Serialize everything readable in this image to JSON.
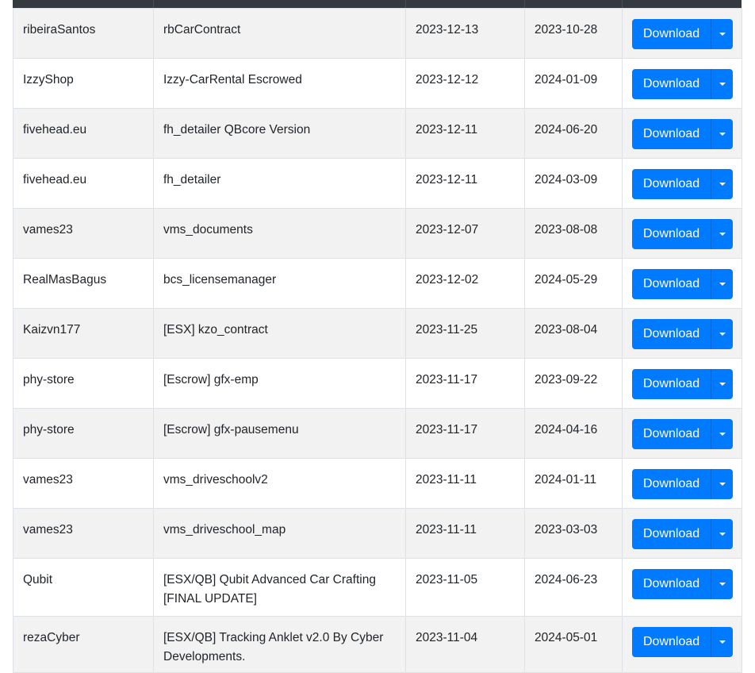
{
  "colors": {
    "header_bg": "#343a40",
    "button_primary": "#007bff",
    "stripe": "#f2f2f2"
  },
  "rows": [
    {
      "author": "ribeiraSantos",
      "name": "rbCarContract",
      "date1": "2023-12-13",
      "date2": "2023-10-28",
      "action": "Download"
    },
    {
      "author": "IzzyShop",
      "name": "Izzy-CarRental Escrowed",
      "date1": "2023-12-12",
      "date2": "2024-01-09",
      "action": "Download"
    },
    {
      "author": "fivehead.eu",
      "name": "fh_detailer QBcore Version",
      "date1": "2023-12-11",
      "date2": "2024-06-20",
      "action": "Download"
    },
    {
      "author": "fivehead.eu",
      "name": "fh_detailer",
      "date1": "2023-12-11",
      "date2": "2024-03-09",
      "action": "Download"
    },
    {
      "author": "vames23",
      "name": "vms_documents",
      "date1": "2023-12-07",
      "date2": "2023-08-08",
      "action": "Download"
    },
    {
      "author": "RealMasBagus",
      "name": "bcs_licensemanager",
      "date1": "2023-12-02",
      "date2": "2024-05-29",
      "action": "Download"
    },
    {
      "author": "Kaizvn177",
      "name": "[ESX] kzo_contract",
      "date1": "2023-11-25",
      "date2": "2023-08-04",
      "action": "Download"
    },
    {
      "author": "phy-store",
      "name": "[Escrow] gfx-emp",
      "date1": "2023-11-17",
      "date2": "2023-09-22",
      "action": "Download"
    },
    {
      "author": "phy-store",
      "name": "[Escrow] gfx-pausemenu",
      "date1": "2023-11-17",
      "date2": "2024-04-16",
      "action": "Download"
    },
    {
      "author": "vames23",
      "name": "vms_driveschoolv2",
      "date1": "2023-11-11",
      "date2": "2024-01-11",
      "action": "Download"
    },
    {
      "author": "vames23",
      "name": "vms_driveschool_map",
      "date1": "2023-11-11",
      "date2": "2023-03-03",
      "action": "Download"
    },
    {
      "author": "Qubit",
      "name": "[ESX/QB] Qubit Advanced Car Crafting [FINAL UPDATE]",
      "date1": "2023-11-05",
      "date2": "2024-06-23",
      "action": "Download"
    },
    {
      "author": "rezaCyber",
      "name": "[ESX/QB] Tracking Anklet v2.0 By Cyber Developments.",
      "date1": "2023-11-04",
      "date2": "2024-05-01",
      "action": "Download"
    }
  ]
}
